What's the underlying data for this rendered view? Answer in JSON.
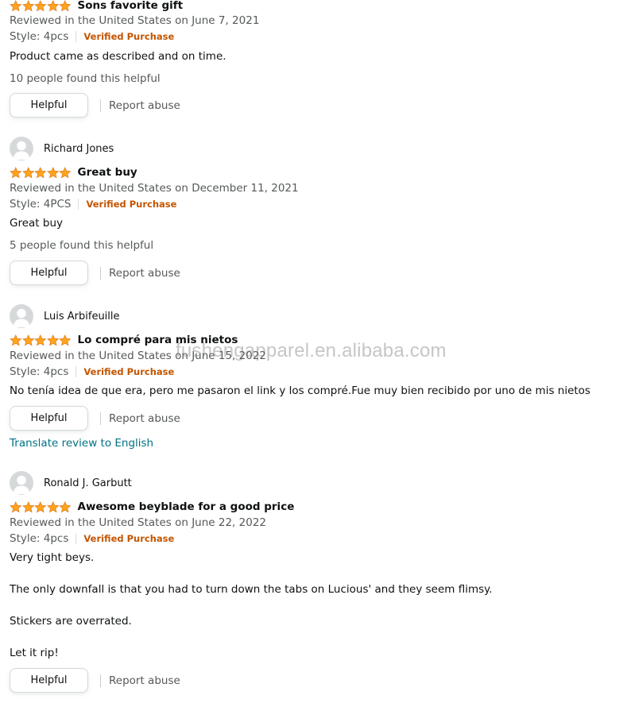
{
  "colors": {
    "star": "#ffa41c",
    "verified": "#c45500",
    "link": "#007185"
  },
  "review1": {
    "rating": 5,
    "title": "Sons favorite gift",
    "meta": "Reviewed in the United States on June 7, 2021",
    "style": "Style: 4pcs",
    "verified": "Verified Purchase",
    "body": [
      "Product came as described and on time."
    ],
    "helpful_count": "10 people found this helpful",
    "helpful_label": "Helpful",
    "report_label": "Report abuse"
  },
  "review2": {
    "author": "Richard Jones",
    "rating": 5,
    "title": "Great buy",
    "meta": "Reviewed in the United States on December 11, 2021",
    "style": "Style: 4PCS",
    "verified": "Verified Purchase",
    "body": [
      "Great buy"
    ],
    "helpful_count": "5 people found this helpful",
    "helpful_label": "Helpful",
    "report_label": "Report abuse"
  },
  "review3": {
    "author": "Luis Arbifeuille",
    "rating": 5,
    "title": "Lo compré para mis nietos",
    "meta": "Reviewed in the United States on June 15, 2022",
    "style": "Style: 4pcs",
    "verified": "Verified Purchase",
    "body": [
      "No tenía idea de que era, pero me pasaron el link y los compré.Fue muy bien recibido por uno de mis nietos"
    ],
    "helpful_label": "Helpful",
    "report_label": "Report abuse",
    "translate_label": "Translate review to English"
  },
  "review4": {
    "author": "Ronald J. Garbutt",
    "rating": 5,
    "title": "Awesome beyblade for a good price",
    "meta": "Reviewed in the United States on June 22, 2022",
    "style": "Style: 4pcs",
    "verified": "Verified Purchase",
    "body": [
      "Very tight beys.",
      "The only downfall is that you had to turn down the tabs on Lucious' and they seem flimsy.",
      "Stickers are overrated.",
      "Let it rip!"
    ],
    "helpful_label": "Helpful",
    "report_label": "Report abuse"
  },
  "watermark": "fushengapparel.en.alibaba.com"
}
